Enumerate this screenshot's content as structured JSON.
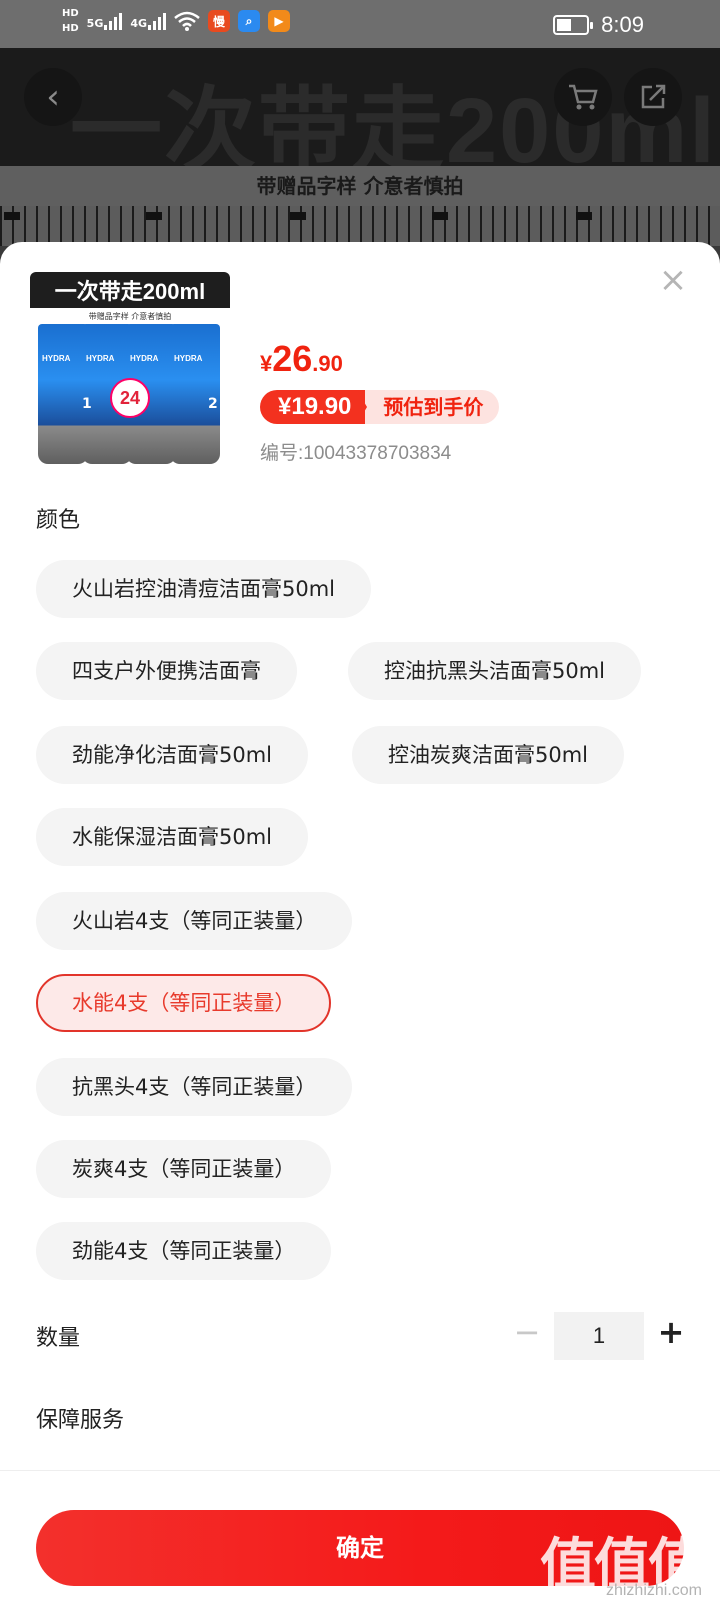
{
  "status_bar": {
    "hd1": "HD",
    "hd2": "HD",
    "net1": "5G",
    "net2": "4G",
    "time": "8:09",
    "battery_level": 0.5
  },
  "background": {
    "banner_text": "一次带走200ml",
    "notice": "带赠品字样 介意者慎拍"
  },
  "product": {
    "image_title": "一次带走200ml",
    "image_subtitle": "带赠品字样 介意者慎拍",
    "price_currency": "¥",
    "price_integer": "26",
    "price_decimal": ".90",
    "estimated_price": "¥19.90",
    "estimated_label": "预估到手价",
    "sku_number": "编号:10043378703834"
  },
  "color_section": {
    "title": "颜色",
    "options": [
      {
        "label": "火山岩控油清痘洁面膏50ml",
        "selected": false
      },
      {
        "label": "四支户外便携洁面膏",
        "selected": false
      },
      {
        "label": "控油抗黑头洁面膏50ml",
        "selected": false
      },
      {
        "label": "劲能净化洁面膏50ml",
        "selected": false
      },
      {
        "label": "控油炭爽洁面膏50ml",
        "selected": false
      },
      {
        "label": "水能保湿洁面膏50ml",
        "selected": false
      },
      {
        "label": "火山岩4支（等同正装量）",
        "selected": false
      },
      {
        "label": "水能4支（等同正装量）",
        "selected": true
      },
      {
        "label": "抗黑头4支（等同正装量）",
        "selected": false
      },
      {
        "label": "炭爽4支（等同正装量）",
        "selected": false
      },
      {
        "label": "劲能4支（等同正装量）",
        "selected": false
      }
    ]
  },
  "quantity": {
    "label": "数量",
    "minus": "−",
    "value": "1",
    "plus": "+"
  },
  "guarantee": {
    "label": "保障服务"
  },
  "confirm_label": "确定",
  "watermark": {
    "text": "值值值",
    "site": "zhizhizhi.com"
  },
  "colors": {
    "accent": "#f0230f",
    "selected_border": "#e2342a",
    "option_bg": "#f4f4f4"
  }
}
